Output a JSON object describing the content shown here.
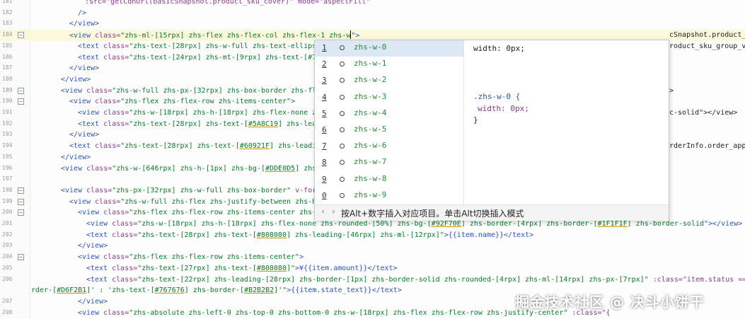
{
  "editor": {
    "lines": [
      {
        "num": "181",
        "fold": false,
        "indent": 120,
        "segments": [
          {
            "t": ":src=\"getCdnUrl(basicSnapshot.product_sku_cover)\" mode=\"aspectFill\"",
            "c": "attr"
          }
        ]
      },
      {
        "num": "182",
        "fold": false,
        "indent": 110,
        "segments": [
          {
            "t": "/>",
            "c": "tag"
          }
        ]
      },
      {
        "num": "183",
        "fold": false,
        "indent": 98,
        "segments": [
          {
            "t": "</view>",
            "c": "tag"
          }
        ]
      },
      {
        "num": "184",
        "fold": true,
        "indent": 98,
        "highlight": true,
        "cursor": true,
        "segments": [
          {
            "t": "<view ",
            "c": "tag"
          },
          {
            "t": "class=",
            "c": "attr"
          },
          {
            "t": "\"zhs-ml-[15rpx] zhs-flex zhs-flex-col zhs-flex-1 zhs-w",
            "c": "str"
          },
          {
            "t": "\">",
            "c": "tag"
          }
        ]
      },
      {
        "num": "185",
        "fold": false,
        "indent": 110,
        "segments": [
          {
            "t": "<text ",
            "c": "tag"
          },
          {
            "t": "class=",
            "c": "attr"
          },
          {
            "t": "\"zhs-text-[28rpx] zhs-w-full zhs-text-ellips",
            "c": "str"
          }
        ]
      },
      {
        "num": "186",
        "fold": false,
        "indent": 110,
        "segments": [
          {
            "t": "<text ",
            "c": "tag"
          },
          {
            "t": "class=",
            "c": "attr"
          },
          {
            "t": "\"zhs-text-[24rpx] zhs-mt-[9rpx] zhs-text-[#7",
            "c": "str"
          }
        ]
      },
      {
        "num": "187",
        "fold": false,
        "indent": 98,
        "segments": [
          {
            "t": "</view>",
            "c": "tag"
          }
        ]
      },
      {
        "num": "188",
        "fold": false,
        "indent": 86,
        "segments": [
          {
            "t": "</view>",
            "c": "tag"
          }
        ]
      },
      {
        "num": "189",
        "fold": true,
        "indent": 86,
        "segments": [
          {
            "t": "<view ",
            "c": "tag"
          },
          {
            "t": "class=",
            "c": "attr"
          },
          {
            "t": "\"zhs-w-full zhs-px-[32rpx] zhs-box-border zhs-fl",
            "c": "str"
          }
        ]
      },
      {
        "num": "190",
        "fold": true,
        "indent": 98,
        "segments": [
          {
            "t": "<view ",
            "c": "tag"
          },
          {
            "t": "class=",
            "c": "attr"
          },
          {
            "t": "\"zhs-flex zhs-flex-row zhs-items-center\"",
            "c": "str"
          },
          {
            "t": ">",
            "c": "tag"
          }
        ]
      },
      {
        "num": "191",
        "fold": false,
        "indent": 110,
        "segments": [
          {
            "t": "<view ",
            "c": "tag"
          },
          {
            "t": "class=",
            "c": "attr"
          },
          {
            "t": "\"zhs-w-[18rpx] zhs-h-[18rpx] zhs-flex-none z",
            "c": "str"
          }
        ]
      },
      {
        "num": "192",
        "fold": false,
        "indent": 110,
        "segments": [
          {
            "t": "<text ",
            "c": "tag"
          },
          {
            "t": "class=",
            "c": "attr"
          },
          {
            "t": "\"zhs-text-[28rpx] zhs-text-[",
            "c": "str"
          },
          {
            "t": "#5A8C19",
            "c": "str hexu"
          },
          {
            "t": "] zhs-lea",
            "c": "str"
          }
        ]
      },
      {
        "num": "193",
        "fold": false,
        "indent": 98,
        "segments": [
          {
            "t": "</view>",
            "c": "tag"
          }
        ]
      },
      {
        "num": "194",
        "fold": false,
        "indent": 98,
        "segments": [
          {
            "t": "<text ",
            "c": "tag"
          },
          {
            "t": "class=",
            "c": "attr"
          },
          {
            "t": "\"zhs-text-[28rpx] zhs-text-[",
            "c": "str"
          },
          {
            "t": "#60921F",
            "c": "str hexu"
          },
          {
            "t": "] zhs-leadi",
            "c": "str"
          }
        ]
      },
      {
        "num": "195",
        "fold": false,
        "indent": 86,
        "segments": [
          {
            "t": "</view>",
            "c": "tag"
          }
        ]
      },
      {
        "num": "196",
        "fold": false,
        "indent": 86,
        "segments": [
          {
            "t": "<view ",
            "c": "tag"
          },
          {
            "t": "class=",
            "c": "attr"
          },
          {
            "t": "\"zhs-w-[646rpx] zhs-h-[1px] zhs-bg-[",
            "c": "str"
          },
          {
            "t": "#DDE0D5",
            "c": "str hexu"
          },
          {
            "t": "] zhs",
            "c": "str"
          }
        ]
      },
      {
        "num": "197",
        "fold": false,
        "indent": 86,
        "segments": []
      },
      {
        "num": "198",
        "fold": true,
        "indent": 86,
        "segments": [
          {
            "t": "<view ",
            "c": "tag"
          },
          {
            "t": "class=",
            "c": "attr"
          },
          {
            "t": "\"zhs-px-[32rpx] zhs-w-full zhs-box-border\"",
            "c": "str"
          },
          {
            "t": " v-for",
            "c": "attr"
          }
        ]
      },
      {
        "num": "199",
        "fold": true,
        "indent": 98,
        "segments": [
          {
            "t": "<view ",
            "c": "tag"
          },
          {
            "t": "class=",
            "c": "attr"
          },
          {
            "t": "\"zhs-w-full zhs-flex zhs-justify-between zhs-h",
            "c": "str"
          }
        ]
      },
      {
        "num": "200",
        "fold": true,
        "indent": 110,
        "segments": [
          {
            "t": "<view ",
            "c": "tag"
          },
          {
            "t": "class=",
            "c": "attr"
          },
          {
            "t": "\"zhs-flex zhs-flex-row zhs-items-center zhs-",
            "c": "str"
          }
        ]
      },
      {
        "num": "201",
        "fold": false,
        "indent": 122,
        "segments": [
          {
            "t": "<view ",
            "c": "tag"
          },
          {
            "t": "class=",
            "c": "attr"
          },
          {
            "t": "\"zhs-w-[18rpx] zhs-h-[18rpx] zhs-flex-none zhs-rounded-[50%] zhs-bg-[",
            "c": "str"
          },
          {
            "t": "#92F70E",
            "c": "str hexu"
          },
          {
            "t": "] zhs-border-[4rpx] zhs-border-[",
            "c": "str"
          },
          {
            "t": "#1F1F1F",
            "c": "str hexu"
          },
          {
            "t": "] zhs-border-solid\"",
            "c": "str"
          },
          {
            "t": "></view>",
            "c": "tag"
          }
        ]
      },
      {
        "num": "202",
        "fold": false,
        "indent": 122,
        "segments": [
          {
            "t": "<text ",
            "c": "tag"
          },
          {
            "t": "class=",
            "c": "attr"
          },
          {
            "t": "\"zhs-text-[28rpx] zhs-text-[",
            "c": "str"
          },
          {
            "t": "#808080",
            "c": "str hexu"
          },
          {
            "t": "] zhs-leading-[46rpx] zhs-ml-[12rpx]\"",
            "c": "str"
          },
          {
            "t": ">{{item.name}}</text>",
            "c": "tag"
          }
        ]
      },
      {
        "num": "203",
        "fold": false,
        "indent": 110,
        "segments": [
          {
            "t": "</view>",
            "c": "tag"
          }
        ]
      },
      {
        "num": "204",
        "fold": true,
        "indent": 110,
        "segments": [
          {
            "t": "<view ",
            "c": "tag"
          },
          {
            "t": "class=",
            "c": "attr"
          },
          {
            "t": "\"zhs-flex zhs-flex-row zhs-items-center\"",
            "c": "str"
          },
          {
            "t": ">",
            "c": "tag"
          }
        ]
      },
      {
        "num": "205",
        "fold": false,
        "indent": 122,
        "segments": [
          {
            "t": "<text ",
            "c": "tag"
          },
          {
            "t": "class=",
            "c": "attr"
          },
          {
            "t": "\"zhs-text-[27rpx] zhs-text-[",
            "c": "str"
          },
          {
            "t": "#808080",
            "c": "str hexu"
          },
          {
            "t": "]\"",
            "c": "str"
          },
          {
            "t": ">¥{{item.amount}}</text>",
            "c": "tag"
          }
        ]
      },
      {
        "num": "206",
        "fold": false,
        "indent": 122,
        "segments": [
          {
            "t": "<text ",
            "c": "tag"
          },
          {
            "t": "class=",
            "c": "attr"
          },
          {
            "t": "\"zhs-text-[22rpx] zhs-leading-[28rpx] zhs-border-[1px] zhs-border-solid zhs-rounded-[4rpx] zhs-ml-[14rpx] zhs-px-[7rpx]\"",
            "c": "str"
          },
          {
            "t": " :class=\"item.status ==",
            "c": "attr"
          }
        ]
      },
      {
        "num": "",
        "fold": false,
        "indent": 44,
        "segments": [
          {
            "t": "rder-[",
            "c": "str"
          },
          {
            "t": "#D6F2B1",
            "c": "str hexu"
          },
          {
            "t": "]' : 'zhs-text-[",
            "c": "str"
          },
          {
            "t": "#767676",
            "c": "str hexu"
          },
          {
            "t": "] zhs-border-[",
            "c": "str"
          },
          {
            "t": "#B2B2B2",
            "c": "str hexu"
          },
          {
            "t": "]'\"",
            "c": "str"
          },
          {
            "t": ">{{item.state_text}}</text>",
            "c": "tag"
          }
        ]
      },
      {
        "num": "207",
        "fold": false,
        "indent": 110,
        "segments": [
          {
            "t": "</view>",
            "c": "tag"
          }
        ]
      },
      {
        "num": "208",
        "fold": false,
        "indent": 110,
        "segments": [
          {
            "t": "<view ",
            "c": "tag"
          },
          {
            "t": "class=",
            "c": "attr"
          },
          {
            "t": "\"zhs-absolute zhs-left-0 zhs-top-0 zhs-bottom-0 zhs-w-[18rpx] zhs-flex zhs-flex-row zhs-justify-center\"",
            "c": "str"
          },
          {
            "t": " :class=\"{",
            "c": "attr"
          }
        ]
      }
    ],
    "right_peek": [
      {
        "row": 3,
        "text": "cSnapshot.product_"
      },
      {
        "row": 4,
        "text": "roduct_sku_group_va"
      },
      {
        "row": 8,
        "text": ">"
      },
      {
        "row": 10,
        "text": "c-solid\"></view>"
      },
      {
        "row": 13,
        "text": "rderInfo.order_appl"
      }
    ]
  },
  "autocomplete": {
    "items": [
      {
        "num": "1",
        "label": "zhs-w-0"
      },
      {
        "num": "2",
        "label": "zhs-w-1"
      },
      {
        "num": "3",
        "label": "zhs-w-2"
      },
      {
        "num": "4",
        "label": "zhs-w-3"
      },
      {
        "num": "5",
        "label": "zhs-w-4"
      },
      {
        "num": "6",
        "label": "zhs-w-5"
      },
      {
        "num": "7",
        "label": "zhs-w-6"
      },
      {
        "num": "8",
        "label": "zhs-w-7"
      },
      {
        "num": "9",
        "label": "zhs-w-8"
      },
      {
        "num": "0",
        "label": "zhs-w-9"
      }
    ],
    "selected_index": 0,
    "detail": {
      "summary": "width: 0px;",
      "selector": ".zhs-w-0 {",
      "property": "width: 0px;",
      "close": "}"
    },
    "footer_nav": "‹ ›",
    "footer_hint": "按Alt+数字插入对应项目。单击Alt切换插入模式"
  },
  "watermark": "掘金技术社区 @ 决斗小饼干"
}
